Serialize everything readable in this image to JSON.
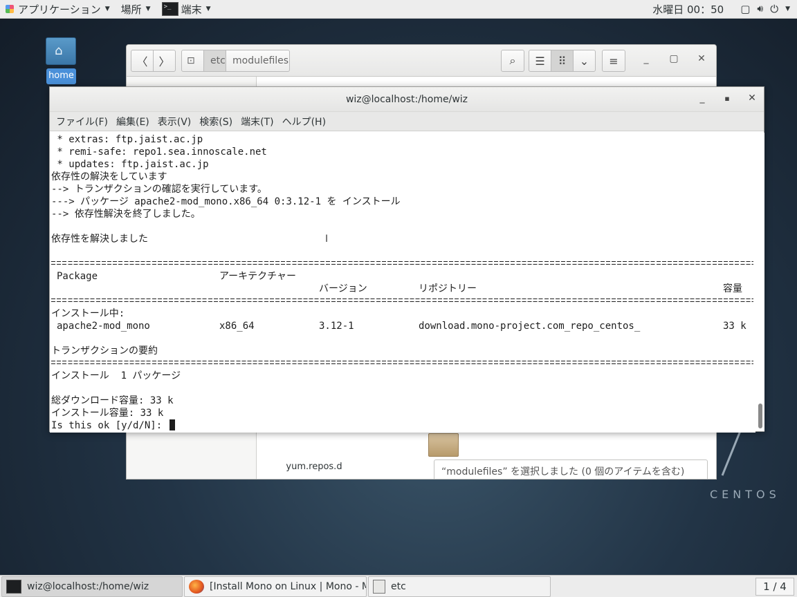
{
  "topbar": {
    "applications": "アプリケーション",
    "places": "場所",
    "terminal_app": "端末",
    "clock": "水曜日 00：50"
  },
  "desktop": {
    "home_label": "home",
    "centos_label": "CENTOS"
  },
  "files": {
    "path": [
      "etc",
      "modulefiles"
    ],
    "folder_label": "yum.repos.d",
    "status": "“modulefiles” を選択しました (0 個のアイテムを含む)"
  },
  "terminal": {
    "title": "wiz@localhost:/home/wiz",
    "menu": [
      "ファイル(F)",
      "編集(E)",
      "表示(V)",
      "検索(S)",
      "端末(T)",
      "ヘルプ(H)"
    ],
    "lines": [
      " * extras: ftp.jaist.ac.jp",
      " * remi-safe: repo1.sea.innoscale.net",
      " * updates: ftp.jaist.ac.jp",
      "依存性の解決をしています",
      "--> トランザクションの確認を実行しています。",
      "---> パッケージ apache2-mod_mono.x86_64 0:3.12-1 を インストール",
      "--> 依存性解決を終了しました。",
      "依存性を解決しました"
    ],
    "table_headers": {
      "package": "Package",
      "arch": "アーキテクチャー",
      "version": "バージョン",
      "repo": "リポジトリー",
      "size": "容量"
    },
    "installing_label": "インストール中:",
    "row": {
      "package": "apache2-mod_mono",
      "arch": "x86_64",
      "version": "3.12-1",
      "repo": "download.mono-project.com_repo_centos_",
      "size": "33 k"
    },
    "summary_title": "トランザクションの要約",
    "install_count": "インストール  1 パッケージ",
    "download_size": "総ダウンロード容量: 33 k",
    "install_size": "インストール容量: 33 k",
    "prompt": "Is this ok [y/d/N]: "
  },
  "taskbar": {
    "tasks": [
      "wiz@localhost:/home/wiz",
      "[Install Mono on Linux | Mono - M…",
      "etc"
    ],
    "pager": "1 / 4"
  }
}
